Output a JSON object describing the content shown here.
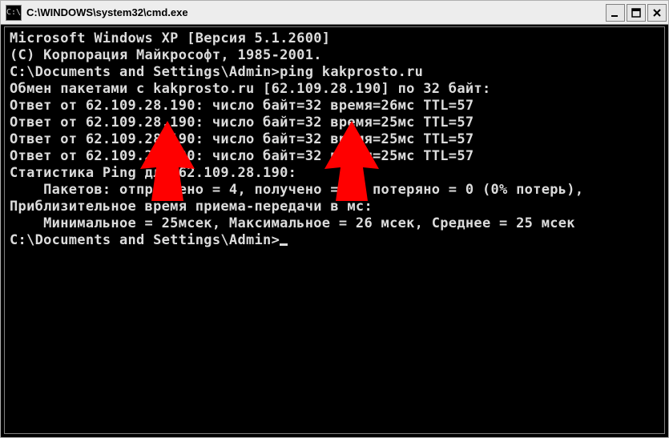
{
  "window": {
    "title": "C:\\WINDOWS\\system32\\cmd.exe",
    "icon_glyph": "C:\\"
  },
  "terminal": {
    "lines": [
      "Microsoft Windows XP [Версия 5.1.2600]",
      "(С) Корпорация Майкрософт, 1985-2001.",
      "",
      "C:\\Documents and Settings\\Admin>ping kakprosto.ru",
      "",
      "Обмен пакетами с kakprosto.ru [62.109.28.190] по 32 байт:",
      "",
      "Ответ от 62.109.28.190: число байт=32 время=26мс TTL=57",
      "Ответ от 62.109.28.190: число байт=32 время=25мс TTL=57",
      "Ответ от 62.109.28.190: число байт=32 время=25мс TTL=57",
      "Ответ от 62.109.28.190: число байт=32 время=25мс TTL=57",
      "",
      "Статистика Ping для 62.109.28.190:",
      "    Пакетов: отправлено = 4, получено = 4, потеряно = 0 (0% потерь),",
      "Приблизительное время приема-передачи в мс:",
      "    Минимальное = 25мсек, Максимальное = 26 мсек, Среднее = 25 мсек",
      "",
      "C:\\Documents and Settings\\Admin>"
    ]
  },
  "annotations": {
    "arrow_color": "#ff0000"
  }
}
